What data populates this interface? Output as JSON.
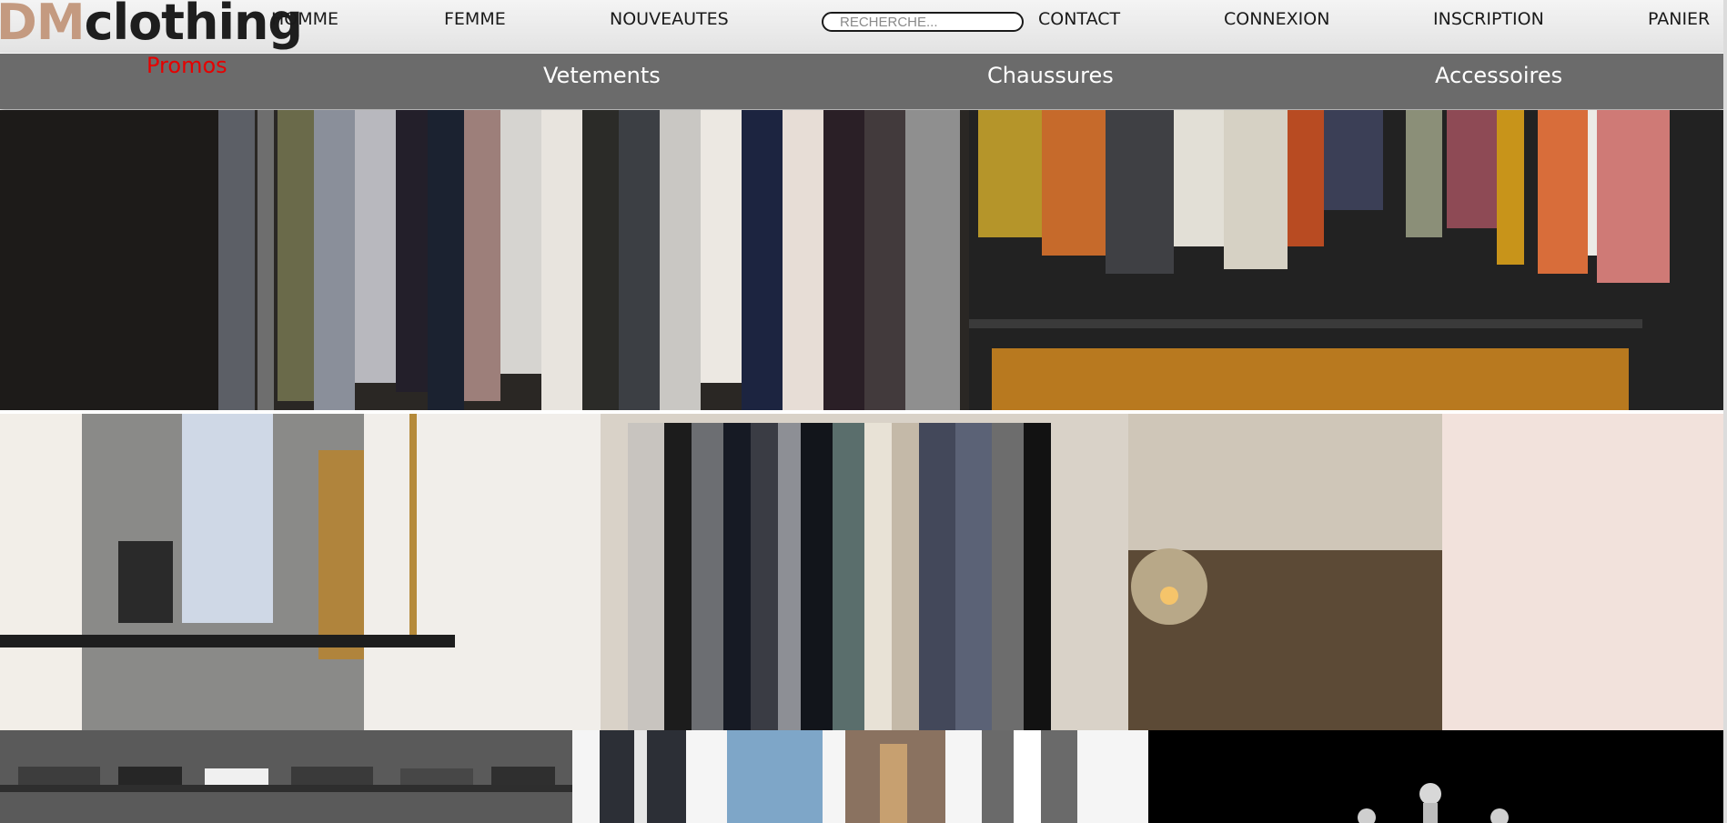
{
  "brand": {
    "part1": "DM",
    "part2": "clothing"
  },
  "nav": {
    "home": "HOMME",
    "women": "FEMME",
    "new": "NOUVEAUTES",
    "contact": "CONTACT",
    "login": "CONNEXION",
    "signup": "INSCRIPTION",
    "cart": "PANIER"
  },
  "search": {
    "placeholder": "RECHERCHE..."
  },
  "categories": {
    "promos": "Promos",
    "clothes": "Vetements",
    "shoes": "Chaussures",
    "accessories": "Accessoires"
  },
  "colors": {
    "brand_accent": "#c49a80",
    "promo": "#e60000",
    "category_bar": "#6b6b6b"
  }
}
